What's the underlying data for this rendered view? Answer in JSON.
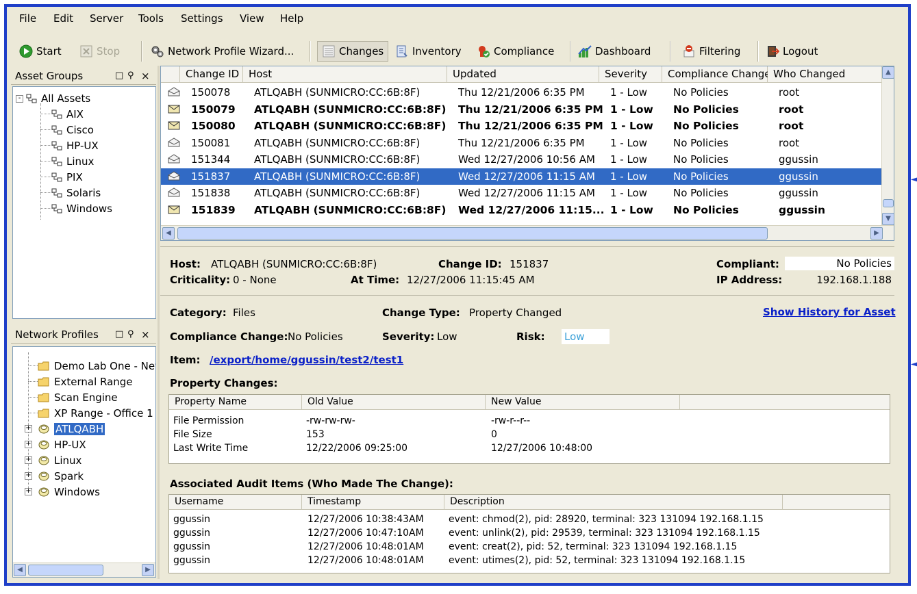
{
  "colors": {
    "frame": "#1f3fc8",
    "selection": "#316ac5",
    "link": "#0b21c8",
    "risk": "#3aa0d8"
  },
  "menu": [
    "File",
    "Edit",
    "Server",
    "Tools",
    "Settings",
    "View",
    "Help"
  ],
  "toolbar": {
    "start": "Start",
    "stop": "Stop",
    "wizard": "Network Profile Wizard...",
    "changes": "Changes",
    "inventory": "Inventory",
    "compliance": "Compliance",
    "dashboard": "Dashboard",
    "filtering": "Filtering",
    "logout": "Logout"
  },
  "asset_groups": {
    "title": "Asset Groups",
    "root": "All Assets",
    "items": [
      "AIX",
      "Cisco",
      "HP-UX",
      "Linux",
      "PIX",
      "Solaris",
      "Windows"
    ]
  },
  "network_profiles": {
    "title": "Network Profiles",
    "folders": [
      "Demo Lab One - Neto",
      "External Range",
      "Scan Engine",
      "XP Range - Office 1"
    ],
    "hosts": [
      "ATLQABH",
      "HP-UX",
      "Linux",
      "Spark",
      "Windows"
    ],
    "selected": "ATLQABH"
  },
  "changes": {
    "columns": [
      "Change ID",
      "Host",
      "Updated",
      "Severity",
      "Compliance Change",
      "Who Changed"
    ],
    "rows": [
      {
        "id": "150078",
        "host": "ATLQABH  (SUNMICRO:CC:6B:8F)",
        "updated": "Thu 12/21/2006 6:35 PM",
        "severity": "1 - Low",
        "compliance": "No Policies",
        "who": "root",
        "unread": false
      },
      {
        "id": "150079",
        "host": "ATLQABH  (SUNMICRO:CC:6B:8F)",
        "updated": "Thu 12/21/2006 6:35 PM",
        "severity": "1 - Low",
        "compliance": "No Policies",
        "who": "root",
        "unread": true
      },
      {
        "id": "150080",
        "host": "ATLQABH  (SUNMICRO:CC:6B:8F)",
        "updated": "Thu 12/21/2006 6:35 PM",
        "severity": "1 - Low",
        "compliance": "No Policies",
        "who": "root",
        "unread": true
      },
      {
        "id": "150081",
        "host": "ATLQABH  (SUNMICRO:CC:6B:8F)",
        "updated": "Thu 12/21/2006 6:35 PM",
        "severity": "1 - Low",
        "compliance": "No Policies",
        "who": "root",
        "unread": false
      },
      {
        "id": "151344",
        "host": "ATLQABH  (SUNMICRO:CC:6B:8F)",
        "updated": "Wed 12/27/2006 10:56 AM",
        "severity": "1 - Low",
        "compliance": "No Policies",
        "who": "ggussin",
        "unread": false
      },
      {
        "id": "151837",
        "host": "ATLQABH  (SUNMICRO:CC:6B:8F)",
        "updated": "Wed 12/27/2006 11:15 AM",
        "severity": "1 - Low",
        "compliance": "No Policies",
        "who": "ggussin",
        "unread": false,
        "selected": true
      },
      {
        "id": "151838",
        "host": "ATLQABH  (SUNMICRO:CC:6B:8F)",
        "updated": "Wed 12/27/2006 11:15 AM",
        "severity": "1 - Low",
        "compliance": "No Policies",
        "who": "ggussin",
        "unread": false
      },
      {
        "id": "151839",
        "host": "ATLQABH  (SUNMICRO:CC:6B:8F)",
        "updated": "Wed 12/27/2006 11:15...",
        "severity": "1 - Low",
        "compliance": "No Policies",
        "who": "ggussin",
        "unread": true
      }
    ]
  },
  "summary": {
    "host_label": "Host:",
    "host": "ATLQABH (SUNMICRO:CC:6B:8F)",
    "change_id_label": "Change ID:",
    "change_id": "151837",
    "compliant_label": "Compliant:",
    "compliant": "No Policies",
    "criticality_label": "Criticality:",
    "criticality": "0 - None",
    "at_time_label": "At Time:",
    "at_time": "12/27/2006 11:15:45 AM",
    "ip_label": "IP Address:",
    "ip": "192.168.1.188"
  },
  "detail": {
    "category_label": "Category:",
    "category": "Files",
    "change_type_label": "Change Type:",
    "change_type": "Property Changed",
    "history_link": "Show History for Asset",
    "compliance_change_label": "Compliance Change:",
    "compliance_change": "No Policies",
    "severity_label": "Severity:",
    "severity": "Low",
    "risk_label": "Risk:",
    "risk": "Low",
    "item_label": "Item:",
    "item": "/export/home/ggussin/test2/test1",
    "property_changes_title": "Property Changes:",
    "property_columns": [
      "Property Name",
      "Old Value",
      "New Value"
    ],
    "property_rows": [
      [
        "File Permission",
        "-rw-rw-rw-",
        "-rw-r--r--"
      ],
      [
        "File Size",
        "153",
        "0"
      ],
      [
        "Last Write Time",
        "12/22/2006 09:25:00",
        "12/27/2006 10:48:00"
      ]
    ],
    "audit_title": "Associated Audit Items (Who Made The Change):",
    "audit_columns": [
      "Username",
      "Timestamp",
      "Description"
    ],
    "audit_rows": [
      [
        "ggussin",
        "12/27/2006 10:38:43AM",
        "event: chmod(2), pid: 28920, terminal: 323 131094 192.168.1.15"
      ],
      [
        "ggussin",
        "12/27/2006 10:47:10AM",
        "event: unlink(2), pid: 29539, terminal: 323 131094 192.168.1.15"
      ],
      [
        "ggussin",
        "12/27/2006 10:48:01AM",
        "event: creat(2), pid: 52, terminal: 323 131094 192.168.1.15"
      ],
      [
        "ggussin",
        "12/27/2006 10:48:01AM",
        "event: utimes(2), pid: 52, terminal: 323 131094 192.168.1.15"
      ]
    ]
  }
}
